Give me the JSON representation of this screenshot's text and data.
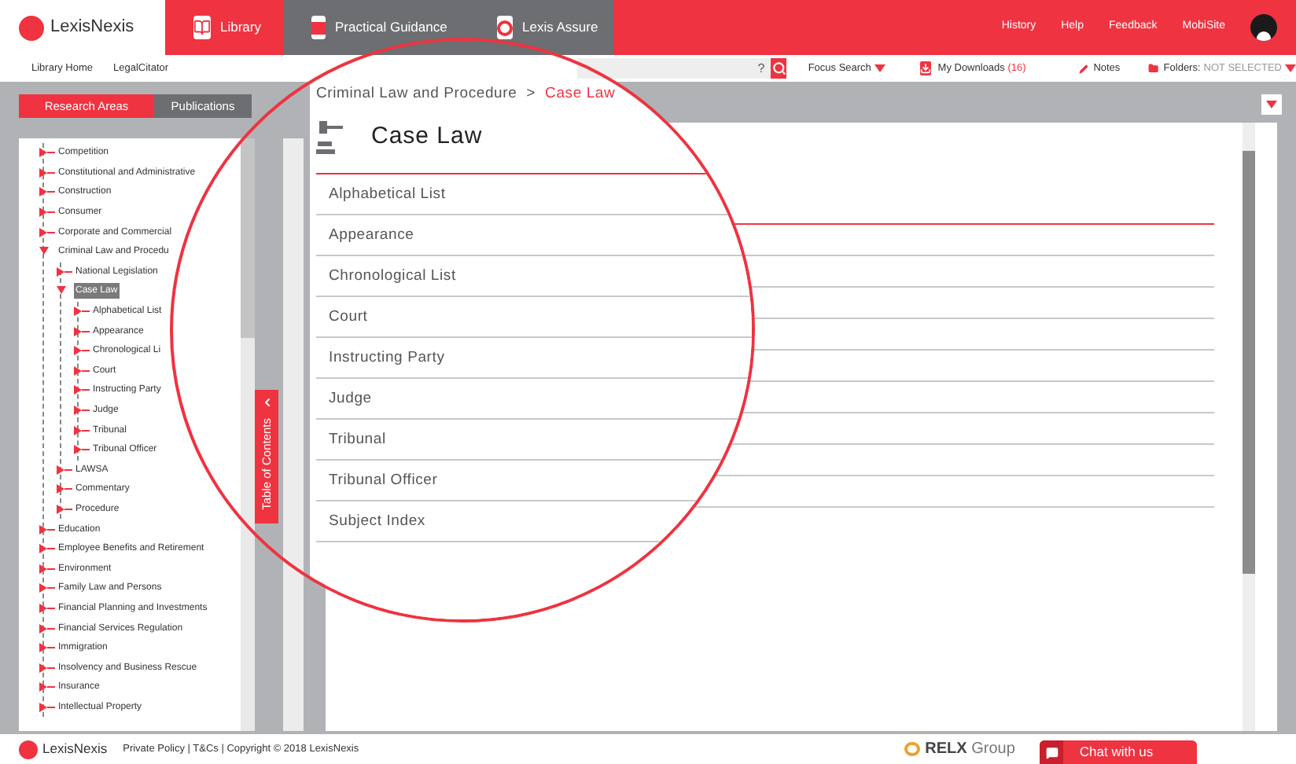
{
  "header": {
    "brand": "LexisNexis",
    "tabs": [
      {
        "label": "Library",
        "kind": "book",
        "selected": true
      },
      {
        "label": "Practical Guidance",
        "kind": "guide",
        "selected": false
      },
      {
        "label": "Lexis Assure",
        "kind": "assure",
        "selected": false
      }
    ],
    "links": [
      "History",
      "Help",
      "Feedback",
      "MobiSite"
    ]
  },
  "toolbar": {
    "links": [
      "Library Home",
      "LegalCitator"
    ],
    "help": "?",
    "focus_search": "Focus Search",
    "downloads": {
      "label": "My Downloads",
      "count": "(16)"
    },
    "notes": "Notes",
    "folders": {
      "label": "Folders:",
      "value": "NOT SELECTED"
    }
  },
  "sidebar": {
    "tabs": [
      {
        "label": "Research Areas",
        "selected": true
      },
      {
        "label": "Publications",
        "selected": false
      }
    ],
    "tree": [
      {
        "label": "Competition",
        "expanded": false,
        "selected": false
      },
      {
        "label": "Constitutional and Administrative",
        "expanded": false,
        "selected": false
      },
      {
        "label": "Construction",
        "expanded": false,
        "selected": false
      },
      {
        "label": "Consumer",
        "expanded": false,
        "selected": false
      },
      {
        "label": "Corporate and Commercial",
        "expanded": false,
        "selected": false
      },
      {
        "label": "Criminal Law and Procedu",
        "expanded": true,
        "selected": false,
        "children": [
          {
            "label": "National Legislation",
            "expanded": false,
            "selected": false
          },
          {
            "label": "Case Law",
            "expanded": true,
            "selected": true,
            "children": [
              {
                "label": "Alphabetical List",
                "expanded": false,
                "selected": false
              },
              {
                "label": "Appearance",
                "expanded": false,
                "selected": false
              },
              {
                "label": "Chronological Li",
                "expanded": false,
                "selected": false
              },
              {
                "label": "Court",
                "expanded": false,
                "selected": false
              },
              {
                "label": "Instructing Party",
                "expanded": false,
                "selected": false
              },
              {
                "label": "Judge",
                "expanded": false,
                "selected": false
              },
              {
                "label": "Tribunal",
                "expanded": false,
                "selected": false
              },
              {
                "label": "Tribunal Officer",
                "expanded": false,
                "selected": false
              }
            ]
          },
          {
            "label": "LAWSA",
            "expanded": false,
            "selected": false
          },
          {
            "label": "Commentary",
            "expanded": false,
            "selected": false
          },
          {
            "label": "Procedure",
            "expanded": false,
            "selected": false
          }
        ]
      },
      {
        "label": "Education",
        "expanded": false,
        "selected": false
      },
      {
        "label": "Employee Benefits and Retirement",
        "expanded": false,
        "selected": false
      },
      {
        "label": "Environment",
        "expanded": false,
        "selected": false
      },
      {
        "label": "Family Law and Persons",
        "expanded": false,
        "selected": false
      },
      {
        "label": "Financial Planning and Investments",
        "expanded": false,
        "selected": false
      },
      {
        "label": "Financial Services Regulation",
        "expanded": false,
        "selected": false
      },
      {
        "label": "Immigration",
        "expanded": false,
        "selected": false
      },
      {
        "label": "Insolvency and Business Rescue",
        "expanded": false,
        "selected": false
      },
      {
        "label": "Insurance",
        "expanded": false,
        "selected": false
      },
      {
        "label": "Intellectual Property",
        "expanded": false,
        "selected": false
      }
    ],
    "toc_tab": "Table of Contents"
  },
  "magnifier": {
    "breadcrumb": [
      "Criminal Law and Procedure",
      "Case Law"
    ],
    "separator": ">",
    "title": "Case Law",
    "items": [
      "Alphabetical List",
      "Appearance",
      "Chronological List",
      "Court",
      "Instructing Party",
      "Judge",
      "Tribunal",
      "Tribunal Officer",
      "Subject Index"
    ]
  },
  "footer": {
    "brand": "LexisNexis",
    "text": "Private Policy | T&Cs | Copyright © 2018 LexisNexis",
    "relx": "RELX",
    "group": "Group",
    "chat": "Chat with us"
  }
}
